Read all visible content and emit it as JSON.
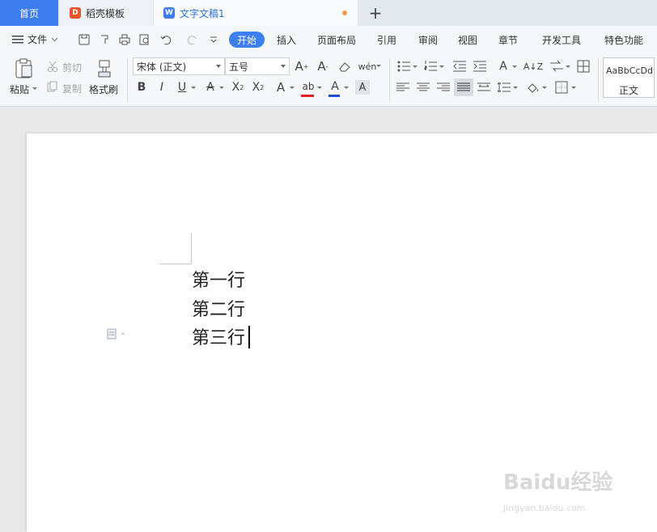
{
  "tabs": {
    "home": "首页",
    "template": "稻壳模板",
    "document": "文字文稿1",
    "new_tab_icon": "+"
  },
  "menu": {
    "file": "文件",
    "items": [
      "开始",
      "插入",
      "页面布局",
      "引用",
      "审阅",
      "视图",
      "章节",
      "开发工具",
      "特色功能"
    ]
  },
  "ribbon": {
    "paste": "粘贴",
    "cut": "剪切",
    "copy": "复制",
    "format_painter": "格式刷",
    "font_name": "宋体 (正文)",
    "font_size": "五号",
    "style_preview": "AaBbCcDd",
    "style_name": "正文"
  },
  "document": {
    "lines": [
      "第一行",
      "第二行",
      "第三行"
    ]
  },
  "watermark": {
    "brand": "Baidu经验",
    "url": "jingyan.baidu.com"
  },
  "colors": {
    "accent": "#3d7ff0",
    "unsaved_dot": "#f49a4a",
    "font_color_underline": "#1f4fd1",
    "highlight_underline": "#e02020"
  }
}
